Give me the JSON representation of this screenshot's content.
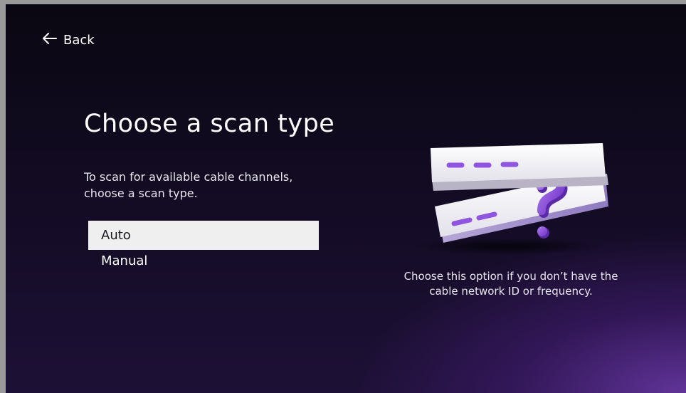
{
  "header": {
    "back_label": "Back"
  },
  "main": {
    "title": "Choose a scan type",
    "subtitle": "To scan for available cable channels, choose a scan type.",
    "options": [
      {
        "label": "Auto",
        "selected": true
      },
      {
        "label": "Manual",
        "selected": false
      }
    ],
    "hint": "Choose this option if you don’t have the cable network ID or frequency."
  },
  "colors": {
    "accent_purple": "#9b63e0",
    "background_dark": "#0a0712",
    "selected_bg": "#efefef"
  },
  "icons": {
    "back": "arrow-left-icon",
    "illustration": "scan-cards-question-illustration"
  }
}
